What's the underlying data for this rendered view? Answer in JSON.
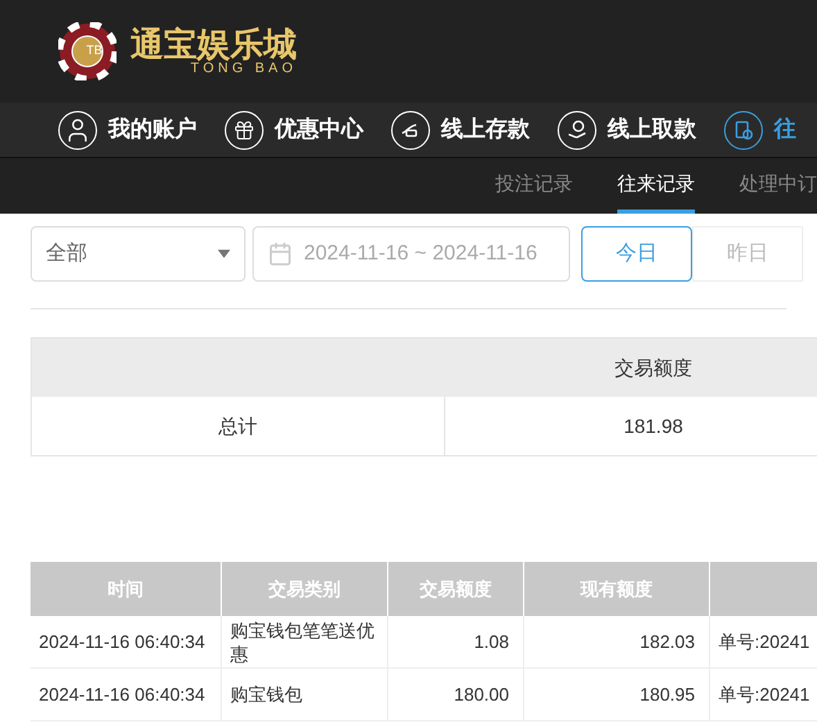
{
  "logo": {
    "badge": "TB",
    "name": "通宝娱乐城",
    "subtitle": "TONG BAO"
  },
  "nav": [
    {
      "kind": "user",
      "label": "我的账户",
      "selected": false
    },
    {
      "kind": "gift",
      "label": "优惠中心",
      "selected": false
    },
    {
      "kind": "deposit",
      "label": "线上存款",
      "selected": false
    },
    {
      "kind": "withdraw",
      "label": "线上取款",
      "selected": false
    },
    {
      "kind": "records",
      "label": "往",
      "selected": true
    }
  ],
  "subtabs": [
    {
      "label": "投注记录",
      "selected": false
    },
    {
      "label": "往来记录",
      "selected": true
    },
    {
      "label": "处理中订",
      "selected": false
    }
  ],
  "filters": {
    "type_select": "全部",
    "date_range": "2024-11-16 ~ 2024-11-16",
    "quick": [
      {
        "label": "今日",
        "selected": true
      },
      {
        "label": "昨日",
        "selected": false
      }
    ]
  },
  "summary": {
    "columns": [
      "",
      "交易额度"
    ],
    "row": [
      "总计",
      "181.98"
    ]
  },
  "table": {
    "columns": [
      "时间",
      "交易类别",
      "交易额度",
      "现有额度",
      ""
    ],
    "rows": [
      [
        "2024-11-16 06:40:34",
        "购宝钱包笔笔送优惠",
        "1.08",
        "182.03",
        "单号:20241"
      ],
      [
        "2024-11-16 06:40:34",
        "购宝钱包",
        "180.00",
        "180.95",
        "单号:20241"
      ]
    ]
  }
}
